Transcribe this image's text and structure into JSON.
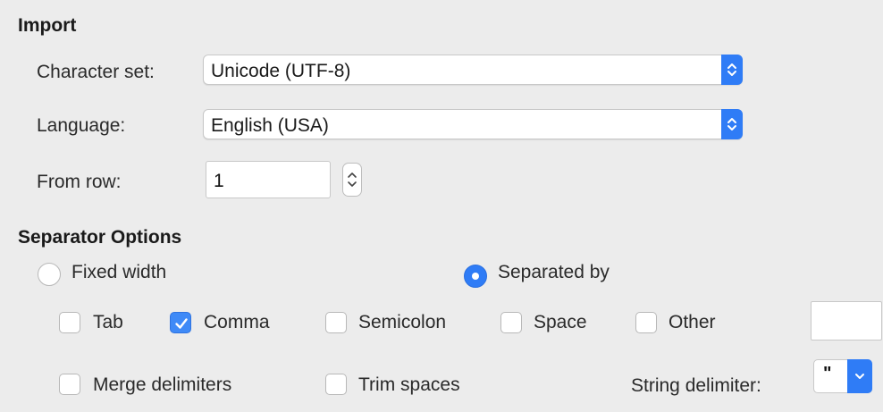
{
  "import": {
    "title": "Import",
    "character_set_label": "Character set:",
    "character_set_value": "Unicode (UTF-8)",
    "language_label": "Language:",
    "language_value": "English (USA)",
    "from_row_label": "From row:",
    "from_row_value": "1"
  },
  "separator": {
    "title": "Separator Options",
    "fixed_width_label": "Fixed width",
    "separated_by_label": "Separated by",
    "mode_selected": "separated_by",
    "tab_label": "Tab",
    "comma_label": "Comma",
    "semicolon_label": "Semicolon",
    "space_label": "Space",
    "other_label": "Other",
    "other_value": "",
    "merge_label": "Merge delimiters",
    "trim_label": "Trim spaces",
    "string_delimiter_label": "String delimiter:",
    "string_delimiter_value": "\"",
    "checked": {
      "tab": false,
      "comma": true,
      "semicolon": false,
      "space": false,
      "other": false,
      "merge": false,
      "trim": false
    }
  },
  "colors": {
    "accent": "#2f7cf6",
    "background": "#ececec"
  },
  "icons": {
    "select_stepper": "chevron-updown-icon",
    "checkmark": "checkmark-icon",
    "dropdown": "chevron-down-icon"
  }
}
